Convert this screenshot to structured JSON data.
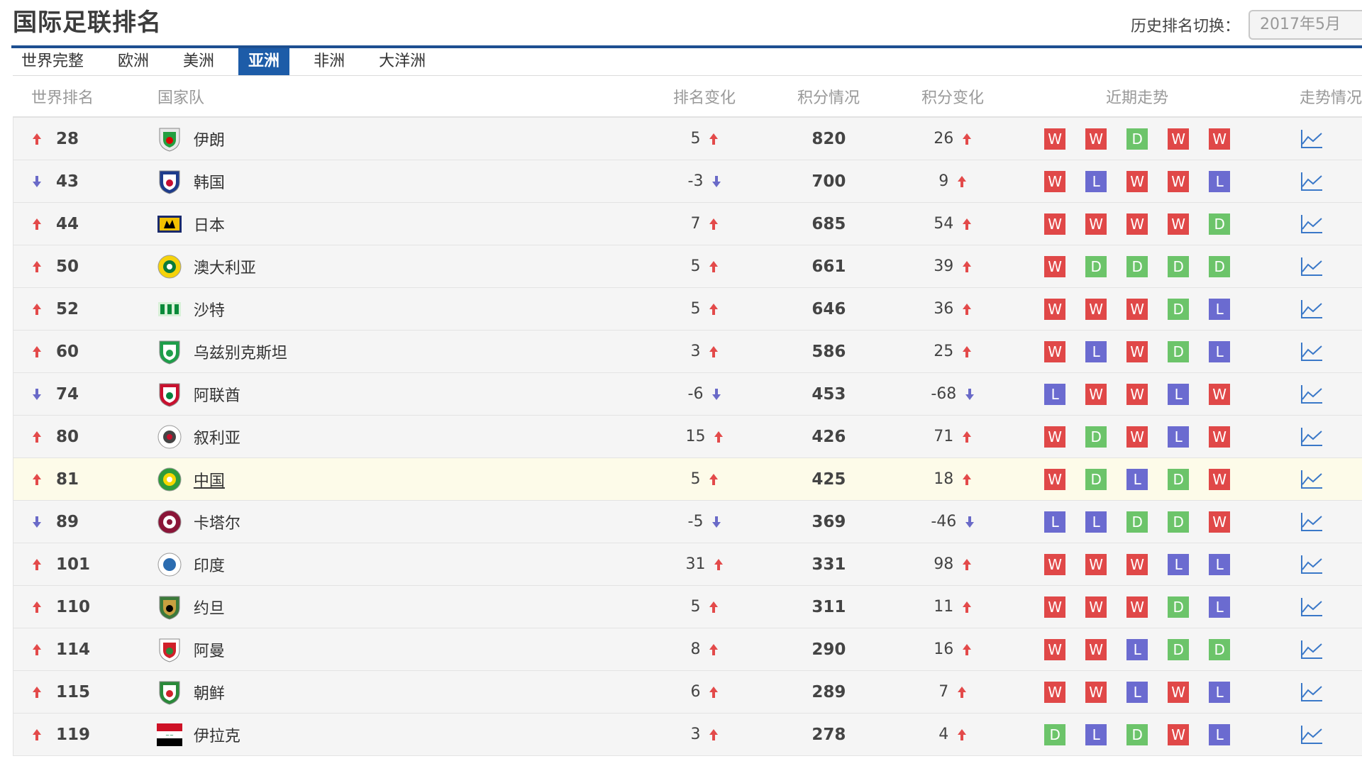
{
  "header": {
    "title": "国际足联排名",
    "history_label": "历史排名切换：",
    "history_value": "2017年5月"
  },
  "tabs": [
    {
      "label": "世界完整",
      "active": false
    },
    {
      "label": "欧洲",
      "active": false
    },
    {
      "label": "美洲",
      "active": false
    },
    {
      "label": "亚洲",
      "active": true
    },
    {
      "label": "非洲",
      "active": false
    },
    {
      "label": "大洋洲",
      "active": false
    }
  ],
  "columns": {
    "rank": "世界排名",
    "team": "国家队",
    "rank_change": "排名变化",
    "points": "积分情况",
    "points_change": "积分变化",
    "form": "近期走势",
    "trend": "走势情况"
  },
  "rows": [
    {
      "rank": "28",
      "rank_dir": "up",
      "team": "伊朗",
      "emblem": "iran-emblem-icon",
      "rank_change": "5",
      "rank_change_dir": "up",
      "points": "820",
      "points_change": "26",
      "points_change_dir": "up",
      "form": [
        "W",
        "W",
        "D",
        "W",
        "W"
      ]
    },
    {
      "rank": "43",
      "rank_dir": "down",
      "team": "韩国",
      "emblem": "korea-emblem-icon",
      "rank_change": "-3",
      "rank_change_dir": "down",
      "points": "700",
      "points_change": "9",
      "points_change_dir": "up",
      "form": [
        "W",
        "L",
        "W",
        "W",
        "L"
      ]
    },
    {
      "rank": "44",
      "rank_dir": "up",
      "team": "日本",
      "emblem": "japan-emblem-icon",
      "rank_change": "7",
      "rank_change_dir": "up",
      "points": "685",
      "points_change": "54",
      "points_change_dir": "up",
      "form": [
        "W",
        "W",
        "W",
        "W",
        "D"
      ]
    },
    {
      "rank": "50",
      "rank_dir": "up",
      "team": "澳大利亚",
      "emblem": "australia-emblem-icon",
      "rank_change": "5",
      "rank_change_dir": "up",
      "points": "661",
      "points_change": "39",
      "points_change_dir": "up",
      "form": [
        "W",
        "D",
        "D",
        "D",
        "D"
      ]
    },
    {
      "rank": "52",
      "rank_dir": "up",
      "team": "沙特",
      "emblem": "saudi-emblem-icon",
      "rank_change": "5",
      "rank_change_dir": "up",
      "points": "646",
      "points_change": "36",
      "points_change_dir": "up",
      "form": [
        "W",
        "W",
        "W",
        "D",
        "L"
      ]
    },
    {
      "rank": "60",
      "rank_dir": "up",
      "team": "乌兹别克斯坦",
      "emblem": "uzbekistan-emblem-icon",
      "rank_change": "3",
      "rank_change_dir": "up",
      "points": "586",
      "points_change": "25",
      "points_change_dir": "up",
      "form": [
        "W",
        "L",
        "W",
        "D",
        "L"
      ]
    },
    {
      "rank": "74",
      "rank_dir": "down",
      "team": "阿联酋",
      "emblem": "uae-emblem-icon",
      "rank_change": "-6",
      "rank_change_dir": "down",
      "points": "453",
      "points_change": "-68",
      "points_change_dir": "down",
      "form": [
        "L",
        "W",
        "W",
        "L",
        "W"
      ]
    },
    {
      "rank": "80",
      "rank_dir": "up",
      "team": "叙利亚",
      "emblem": "syria-emblem-icon",
      "rank_change": "15",
      "rank_change_dir": "up",
      "points": "426",
      "points_change": "71",
      "points_change_dir": "up",
      "form": [
        "W",
        "D",
        "W",
        "L",
        "W"
      ]
    },
    {
      "rank": "81",
      "rank_dir": "up",
      "team": "中国",
      "emblem": "china-emblem-icon",
      "rank_change": "5",
      "rank_change_dir": "up",
      "points": "425",
      "points_change": "18",
      "points_change_dir": "up",
      "form": [
        "W",
        "D",
        "L",
        "D",
        "W"
      ],
      "highlight": true
    },
    {
      "rank": "89",
      "rank_dir": "down",
      "team": "卡塔尔",
      "emblem": "qatar-emblem-icon",
      "rank_change": "-5",
      "rank_change_dir": "down",
      "points": "369",
      "points_change": "-46",
      "points_change_dir": "down",
      "form": [
        "L",
        "L",
        "D",
        "D",
        "W"
      ]
    },
    {
      "rank": "101",
      "rank_dir": "up",
      "team": "印度",
      "emblem": "india-emblem-icon",
      "rank_change": "31",
      "rank_change_dir": "up",
      "points": "331",
      "points_change": "98",
      "points_change_dir": "up",
      "form": [
        "W",
        "W",
        "W",
        "L",
        "L"
      ]
    },
    {
      "rank": "110",
      "rank_dir": "up",
      "team": "约旦",
      "emblem": "jordan-emblem-icon",
      "rank_change": "5",
      "rank_change_dir": "up",
      "points": "311",
      "points_change": "11",
      "points_change_dir": "up",
      "form": [
        "W",
        "W",
        "W",
        "D",
        "L"
      ]
    },
    {
      "rank": "114",
      "rank_dir": "up",
      "team": "阿曼",
      "emblem": "oman-emblem-icon",
      "rank_change": "8",
      "rank_change_dir": "up",
      "points": "290",
      "points_change": "16",
      "points_change_dir": "up",
      "form": [
        "W",
        "W",
        "L",
        "D",
        "D"
      ]
    },
    {
      "rank": "115",
      "rank_dir": "up",
      "team": "朝鲜",
      "emblem": "north-korea-emblem-icon",
      "rank_change": "6",
      "rank_change_dir": "up",
      "points": "289",
      "points_change": "7",
      "points_change_dir": "up",
      "form": [
        "W",
        "W",
        "L",
        "W",
        "L"
      ]
    },
    {
      "rank": "119",
      "rank_dir": "up",
      "team": "伊拉克",
      "emblem": "iraq-emblem-icon",
      "rank_change": "3",
      "rank_change_dir": "up",
      "points": "278",
      "points_change": "4",
      "points_change_dir": "up",
      "form": [
        "D",
        "L",
        "D",
        "W",
        "L"
      ]
    }
  ],
  "colors": {
    "win": "#e04848",
    "draw": "#6cc46a",
    "loss": "#6b6bd0",
    "tab_active": "#1d5ca8",
    "up_arrow": "#e34a4a",
    "down_arrow": "#6a6ac8",
    "highlight_row": "#fdfbe9"
  }
}
